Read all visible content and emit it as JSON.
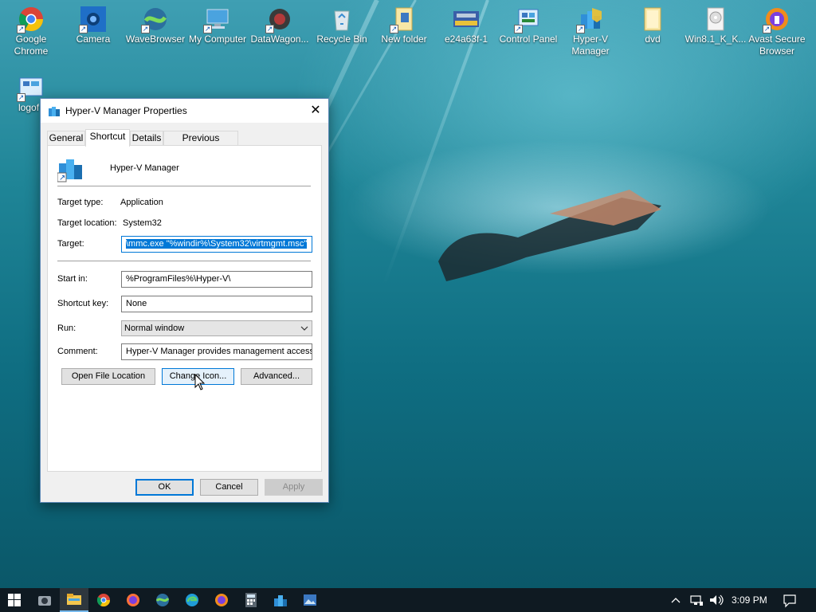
{
  "desktop": {
    "icons": [
      {
        "label": "Google Chrome",
        "icon": "chrome-icon"
      },
      {
        "label": "Camera",
        "icon": "camera-icon"
      },
      {
        "label": "WaveBrowser",
        "icon": "wavebrowser-icon"
      },
      {
        "label": "My Computer",
        "icon": "computer-icon"
      },
      {
        "label": "DataWagon...",
        "icon": "datawagon-icon"
      },
      {
        "label": "Recycle Bin",
        "icon": "recycle-bin-icon"
      },
      {
        "label": "New folder",
        "icon": "folder-icon"
      },
      {
        "label": "e24a63f-1",
        "icon": "image-file-icon"
      },
      {
        "label": "Control Panel",
        "icon": "control-panel-icon"
      },
      {
        "label": "Hyper-V Manager",
        "icon": "hyperv-icon"
      },
      {
        "label": "dvd",
        "icon": "folder-icon"
      },
      {
        "label": "Win8.1_K_K...",
        "icon": "disc-image-icon"
      },
      {
        "label": "Avast Secure Browser",
        "icon": "avast-browser-icon"
      },
      {
        "label": "logof",
        "icon": "logoff-shortcut-icon"
      }
    ]
  },
  "dialog": {
    "title": "Hyper-V Manager Properties",
    "close_label": "✕",
    "tabs": [
      {
        "label": "General",
        "active": false
      },
      {
        "label": "Shortcut",
        "active": true
      },
      {
        "label": "Details",
        "active": false
      },
      {
        "label": "Previous Versions",
        "active": false
      }
    ],
    "shortcut": {
      "name": "Hyper-V Manager",
      "target_type_label": "Target type:",
      "target_type": "Application",
      "target_location_label": "Target location:",
      "target_location": "System32",
      "target_label": "Target:",
      "target_value": "\\mmc.exe \"%windir%\\System32\\virtmgmt.msc\"",
      "start_in_label": "Start in:",
      "start_in_value": "%ProgramFiles%\\Hyper-V\\",
      "shortcut_key_label": "Shortcut key:",
      "shortcut_key_value": "None",
      "run_label": "Run:",
      "run_value": "Normal window",
      "comment_label": "Comment:",
      "comment_value": "Hyper-V Manager provides management access",
      "open_file_location_label": "Open File Location",
      "change_icon_label": "Change Icon...",
      "advanced_label": "Advanced..."
    },
    "buttons": {
      "ok": "OK",
      "cancel": "Cancel",
      "apply": "Apply"
    }
  },
  "taskbar": {
    "items": [
      "start-icon",
      "camera-icon",
      "file-explorer-icon",
      "chrome-icon",
      "firefox-icon",
      "wavebrowser-icon",
      "edge-icon",
      "avast-browser-icon",
      "calculator-icon",
      "hyperv-icon",
      "photos-icon"
    ],
    "time": "3:09 PM"
  },
  "colors": {
    "accent": "#0078d7",
    "taskbar": "#0f1a22"
  }
}
